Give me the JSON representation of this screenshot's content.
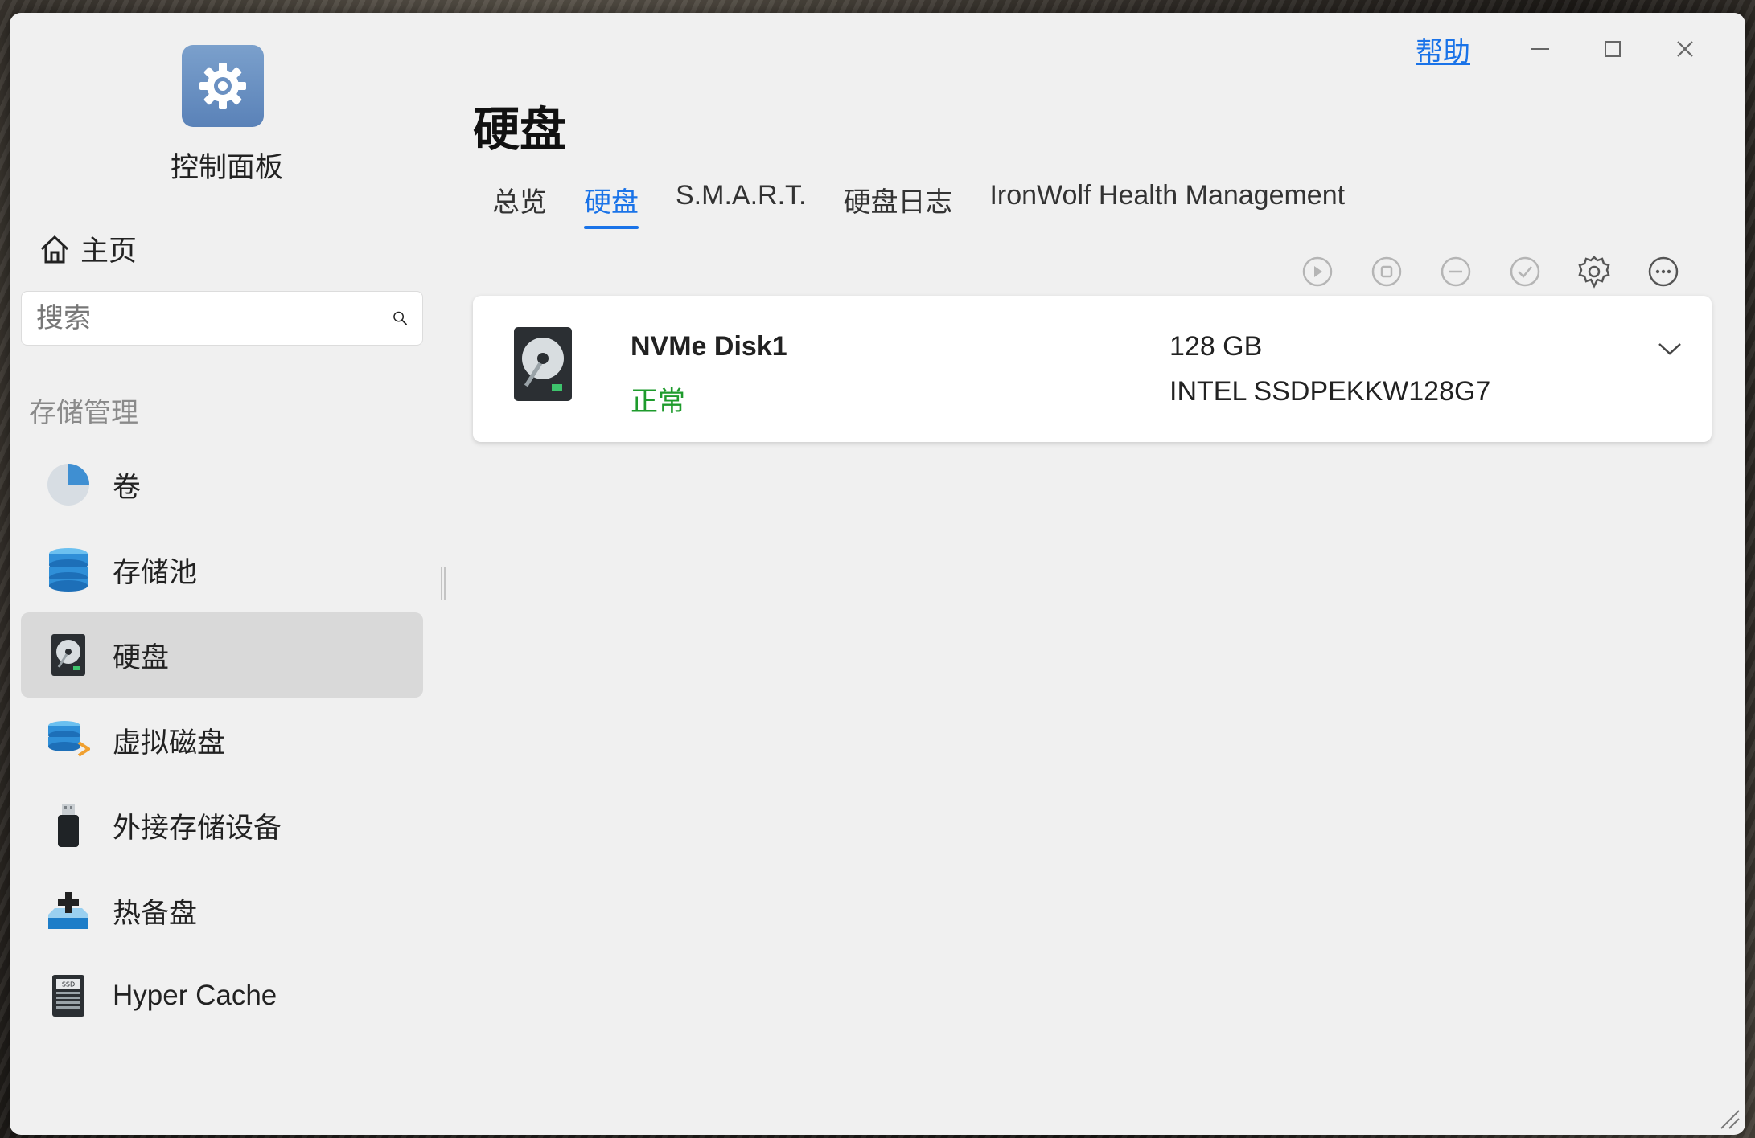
{
  "window": {
    "help_label": "帮助",
    "controls": [
      "minimize",
      "maximize",
      "close"
    ]
  },
  "sidebar": {
    "app_name": "控制面板",
    "home_label": "主页",
    "search": {
      "placeholder": "搜索",
      "value": ""
    },
    "section_label": "存储管理",
    "items": [
      {
        "label": "卷",
        "icon": "volume-pie-icon",
        "active": false
      },
      {
        "label": "存储池",
        "icon": "storage-pool-icon",
        "active": false
      },
      {
        "label": "硬盘",
        "icon": "hard-disk-icon",
        "active": true
      },
      {
        "label": "虚拟磁盘",
        "icon": "virtual-disk-icon",
        "active": false
      },
      {
        "label": "外接存储设备",
        "icon": "usb-drive-icon",
        "active": false
      },
      {
        "label": "热备盘",
        "icon": "hot-spare-icon",
        "active": false
      },
      {
        "label": "Hyper Cache",
        "icon": "ssd-cache-icon",
        "active": false
      }
    ]
  },
  "main": {
    "title": "硬盘",
    "tabs": [
      {
        "label": "总览",
        "active": false
      },
      {
        "label": "硬盘",
        "active": true
      },
      {
        "label": "S.M.A.R.T.",
        "active": false
      },
      {
        "label": "硬盘日志",
        "active": false
      },
      {
        "label": "IronWolf Health Management",
        "active": false
      }
    ],
    "toolbar": [
      "play-icon",
      "stop-icon",
      "minus-icon",
      "check-icon",
      "settings-icon",
      "more-icon"
    ],
    "disks": [
      {
        "name": "NVMe Disk1",
        "status": "正常",
        "size": "128 GB",
        "model": "INTEL SSDPEKKW128G7"
      }
    ]
  },
  "colors": {
    "accent": "#1a73e8",
    "status_ok": "#1e9b2c",
    "window_bg": "#f0f0f0",
    "active_nav_bg": "#d9d9d9"
  }
}
